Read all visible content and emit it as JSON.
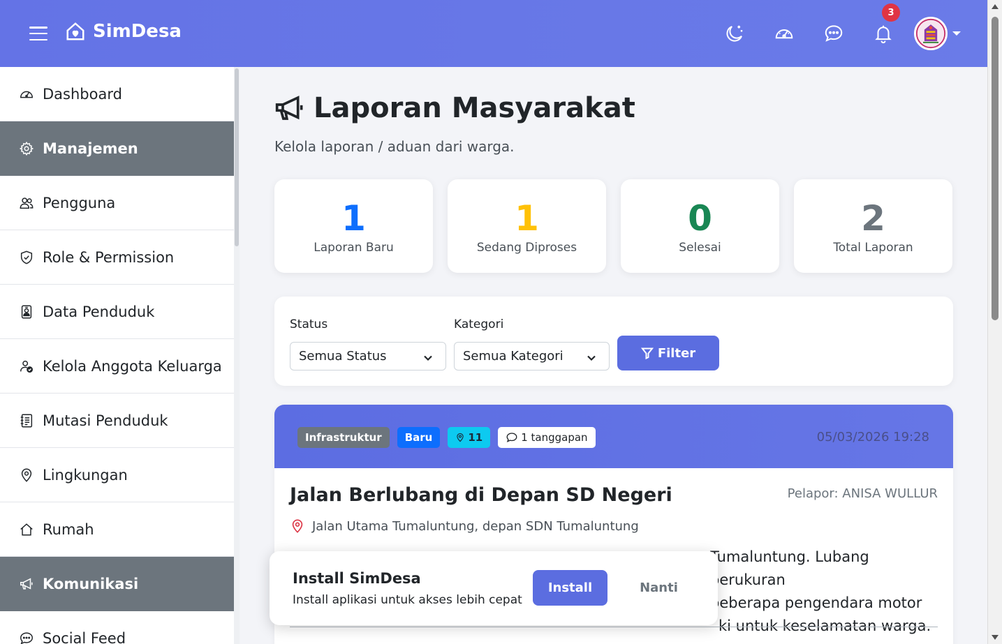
{
  "app": {
    "brand": "SimDesa"
  },
  "topbar": {
    "icons": [
      "theme-toggle-icon",
      "dashboard-gauge-icon",
      "chat-icon",
      "bell-icon"
    ],
    "notification_count": "3"
  },
  "sidebar": {
    "items": [
      {
        "label": "Dashboard",
        "icon": "gauge-icon",
        "section": false
      },
      {
        "label": "Manajemen",
        "icon": "gear-icon",
        "section": true
      },
      {
        "label": "Pengguna",
        "icon": "users-icon",
        "section": false
      },
      {
        "label": "Role & Permission",
        "icon": "shield-icon",
        "section": false
      },
      {
        "label": "Data Penduduk",
        "icon": "person-badge-icon",
        "section": false
      },
      {
        "label": "Kelola Anggota Keluarga",
        "icon": "person-check-icon",
        "section": false
      },
      {
        "label": "Mutasi Penduduk",
        "icon": "journal-icon",
        "section": false
      },
      {
        "label": "Lingkungan",
        "icon": "geo-pin-icon",
        "section": false
      },
      {
        "label": "Rumah",
        "icon": "house-icon",
        "section": false
      },
      {
        "label": "Komunikasi",
        "icon": "megaphone-icon",
        "section": true
      },
      {
        "label": "Social Feed",
        "icon": "chat-dots-icon",
        "section": false
      }
    ]
  },
  "page": {
    "title": "Laporan Masyarakat",
    "subtitle": "Kelola laporan / aduan dari warga."
  },
  "stats": [
    {
      "value": "1",
      "label": "Laporan Baru",
      "color": "#0d6efd"
    },
    {
      "value": "1",
      "label": "Sedang Diproses",
      "color": "#ffc107"
    },
    {
      "value": "0",
      "label": "Selesai",
      "color": "#198754"
    },
    {
      "value": "2",
      "label": "Total Laporan",
      "color": "#6c757d"
    }
  ],
  "filter": {
    "status_label": "Status",
    "status_value": "Semua Status",
    "category_label": "Kategori",
    "category_value": "Semua Kategori",
    "button": "Filter"
  },
  "report": {
    "category": "Infrastruktur",
    "status": "Baru",
    "location_count": "11",
    "responses": "1 tanggapan",
    "date": "05/03/2026 19:28",
    "title": "Jalan Berlubang di Depan SD Negeri",
    "reporter": "Pelapor: ANISA WULLUR",
    "location": "Jalan Utama Tumaluntung, depan SDN Tumaluntung",
    "description_line1_tail": "Tumaluntung. Lubang berukuran",
    "description_line2_tail": "beberapa pengendara motor",
    "description_line3_tail": "ki untuk keselamatan warga."
  },
  "install_prompt": {
    "title": "Install SimDesa",
    "subtitle": "Install aplikasi untuk akses lebih cepat",
    "install_button": "Install",
    "later_button": "Nanti"
  }
}
